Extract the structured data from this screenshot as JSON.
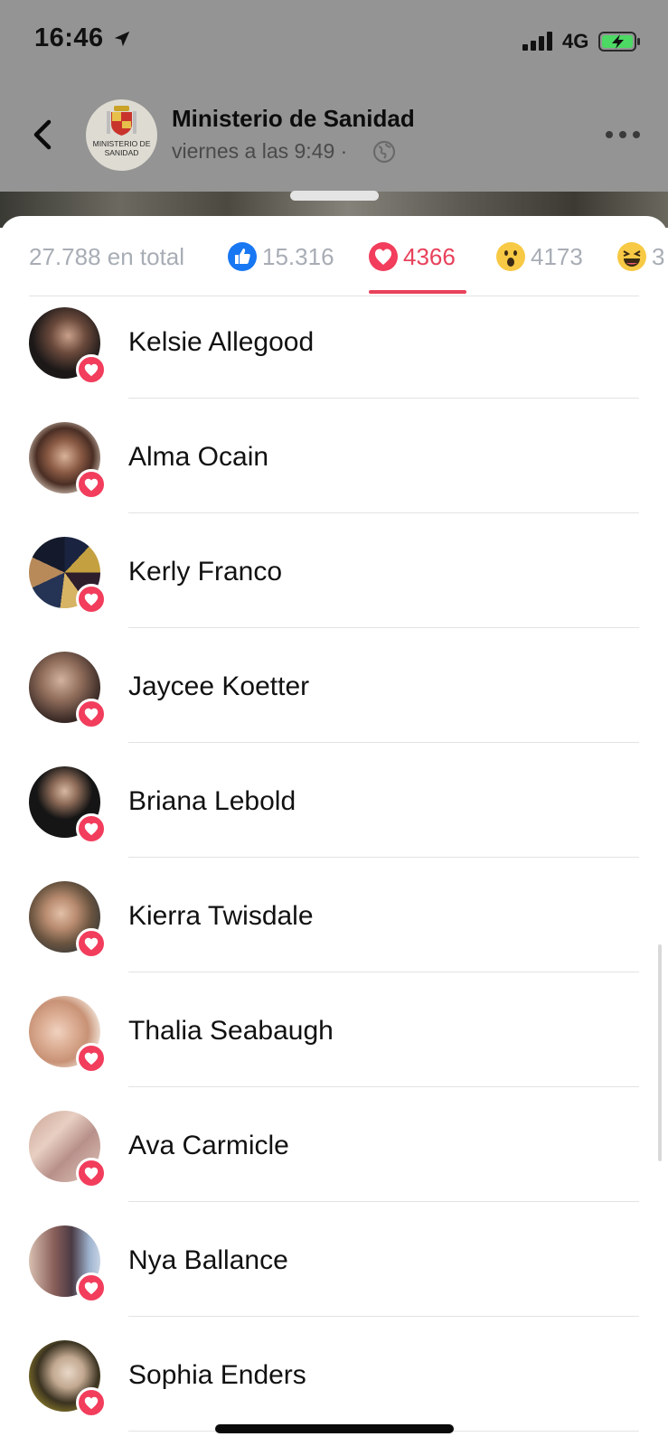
{
  "status_bar": {
    "time": "16:46",
    "network": "4G"
  },
  "header": {
    "page_name": "Ministerio de Sanidad",
    "logo_text": "MINISTERIO DE SANIDAD",
    "meta": "viernes a las 9:49 ·"
  },
  "tabs": [
    {
      "label": "27.788 en total",
      "icon": "",
      "active": false
    },
    {
      "label": "15.316",
      "icon": "like-icon",
      "active": false
    },
    {
      "label": "4366",
      "icon": "love-icon",
      "active": true
    },
    {
      "label": "4173",
      "icon": "wow-icon",
      "active": false
    },
    {
      "label": "3",
      "icon": "haha-icon",
      "active": false
    }
  ],
  "reactions": [
    {
      "name": "Kelsie Allegood",
      "reaction": "love-icon"
    },
    {
      "name": "Alma Ocain",
      "reaction": "love-icon"
    },
    {
      "name": "Kerly Franco",
      "reaction": "love-icon"
    },
    {
      "name": "Jaycee Koetter",
      "reaction": "love-icon"
    },
    {
      "name": "Briana Lebold",
      "reaction": "love-icon"
    },
    {
      "name": "Kierra Twisdale",
      "reaction": "love-icon"
    },
    {
      "name": "Thalia Seabaugh",
      "reaction": "love-icon"
    },
    {
      "name": "Ava Carmicle",
      "reaction": "love-icon"
    },
    {
      "name": "Nya Ballance",
      "reaction": "love-icon"
    },
    {
      "name": "Sophia Enders",
      "reaction": "love-icon"
    }
  ],
  "colors": {
    "accent": "#e8415b",
    "love": "#f23d5c",
    "like": "#1877f2",
    "inactive_text": "#a8adb5"
  }
}
